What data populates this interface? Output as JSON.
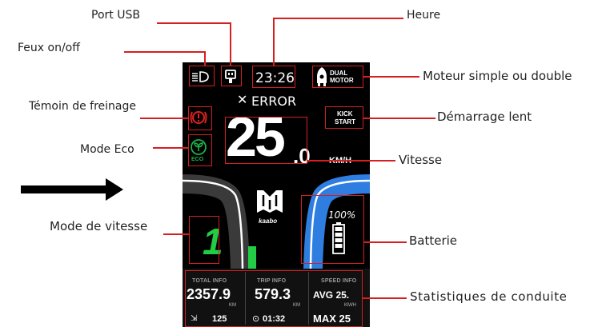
{
  "labels": {
    "usb": "Port USB",
    "time": "Heure",
    "lights": "Feux on/off",
    "motor": "Moteur simple ou double",
    "brake": "Témoin de freinage",
    "kick": "Démarrage lent",
    "eco": "Mode Eco",
    "speed": "Vitesse",
    "speed_mode": "Mode de vitesse",
    "battery": "Batterie",
    "stats": "Statistiques de conduite"
  },
  "screen": {
    "time": "23:26",
    "motor_line1": "DUAL",
    "motor_line2": "MOTOR",
    "error": "ERROR",
    "kick_line1": "KICK",
    "kick_line2": "START",
    "eco": "ECO",
    "speed_int": "25",
    "speed_dec": ".0",
    "speed_unit": "KM/H",
    "brand": "kaabo",
    "gear": "1",
    "battery_percent": "100%",
    "total_header": "TOTAL INFO",
    "total_value": "2357.9",
    "total_unit": "KM",
    "total_sub": "125",
    "trip_header": "TRIP INFO",
    "trip_value": "579.3",
    "trip_unit": "KM",
    "trip_sub": "01:32",
    "speed_header": "SPEED INFO",
    "avg_label": "AVG 25.",
    "avg_unit": "KM/H",
    "max_label": "MAX 25"
  },
  "colors": {
    "annotation": "#d42020",
    "eco_green": "#19b34a",
    "gear_green": "#22cc44",
    "right_arc": "#2e7de0",
    "brake_red": "#e02020"
  }
}
